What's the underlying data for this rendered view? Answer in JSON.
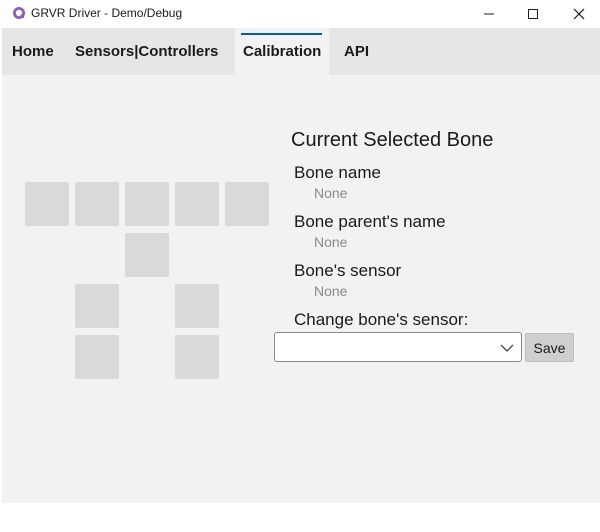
{
  "window": {
    "title": "GRVR Driver - Demo/Debug",
    "controls": [
      "minimize-icon",
      "maximize-icon",
      "close-icon"
    ]
  },
  "nav": {
    "tabs": [
      {
        "label": "Home",
        "selected": false
      },
      {
        "label": "Sensors|Controllers",
        "selected": false
      },
      {
        "label": "Calibration",
        "selected": true
      },
      {
        "label": "API",
        "selected": false
      }
    ]
  },
  "bone_grid": {
    "rows": [
      {
        "count": 5
      },
      {
        "count": 1
      },
      {
        "count": 2
      },
      {
        "count": 2
      }
    ]
  },
  "details": {
    "title": "Current Selected Bone",
    "bone_name_label": "Bone name",
    "bone_name_value": "None",
    "parent_label": "Bone parent's name",
    "parent_value": "None",
    "sensor_label": "Bone's sensor",
    "sensor_value": "None",
    "change_label": "Change bone's sensor:",
    "select_value": "",
    "save_label": "Save"
  },
  "colors": {
    "accent": "#005fb8",
    "tile": "#d9d9d9",
    "nav_bg": "#e6e6e6",
    "content_bg": "#f2f2f2"
  }
}
